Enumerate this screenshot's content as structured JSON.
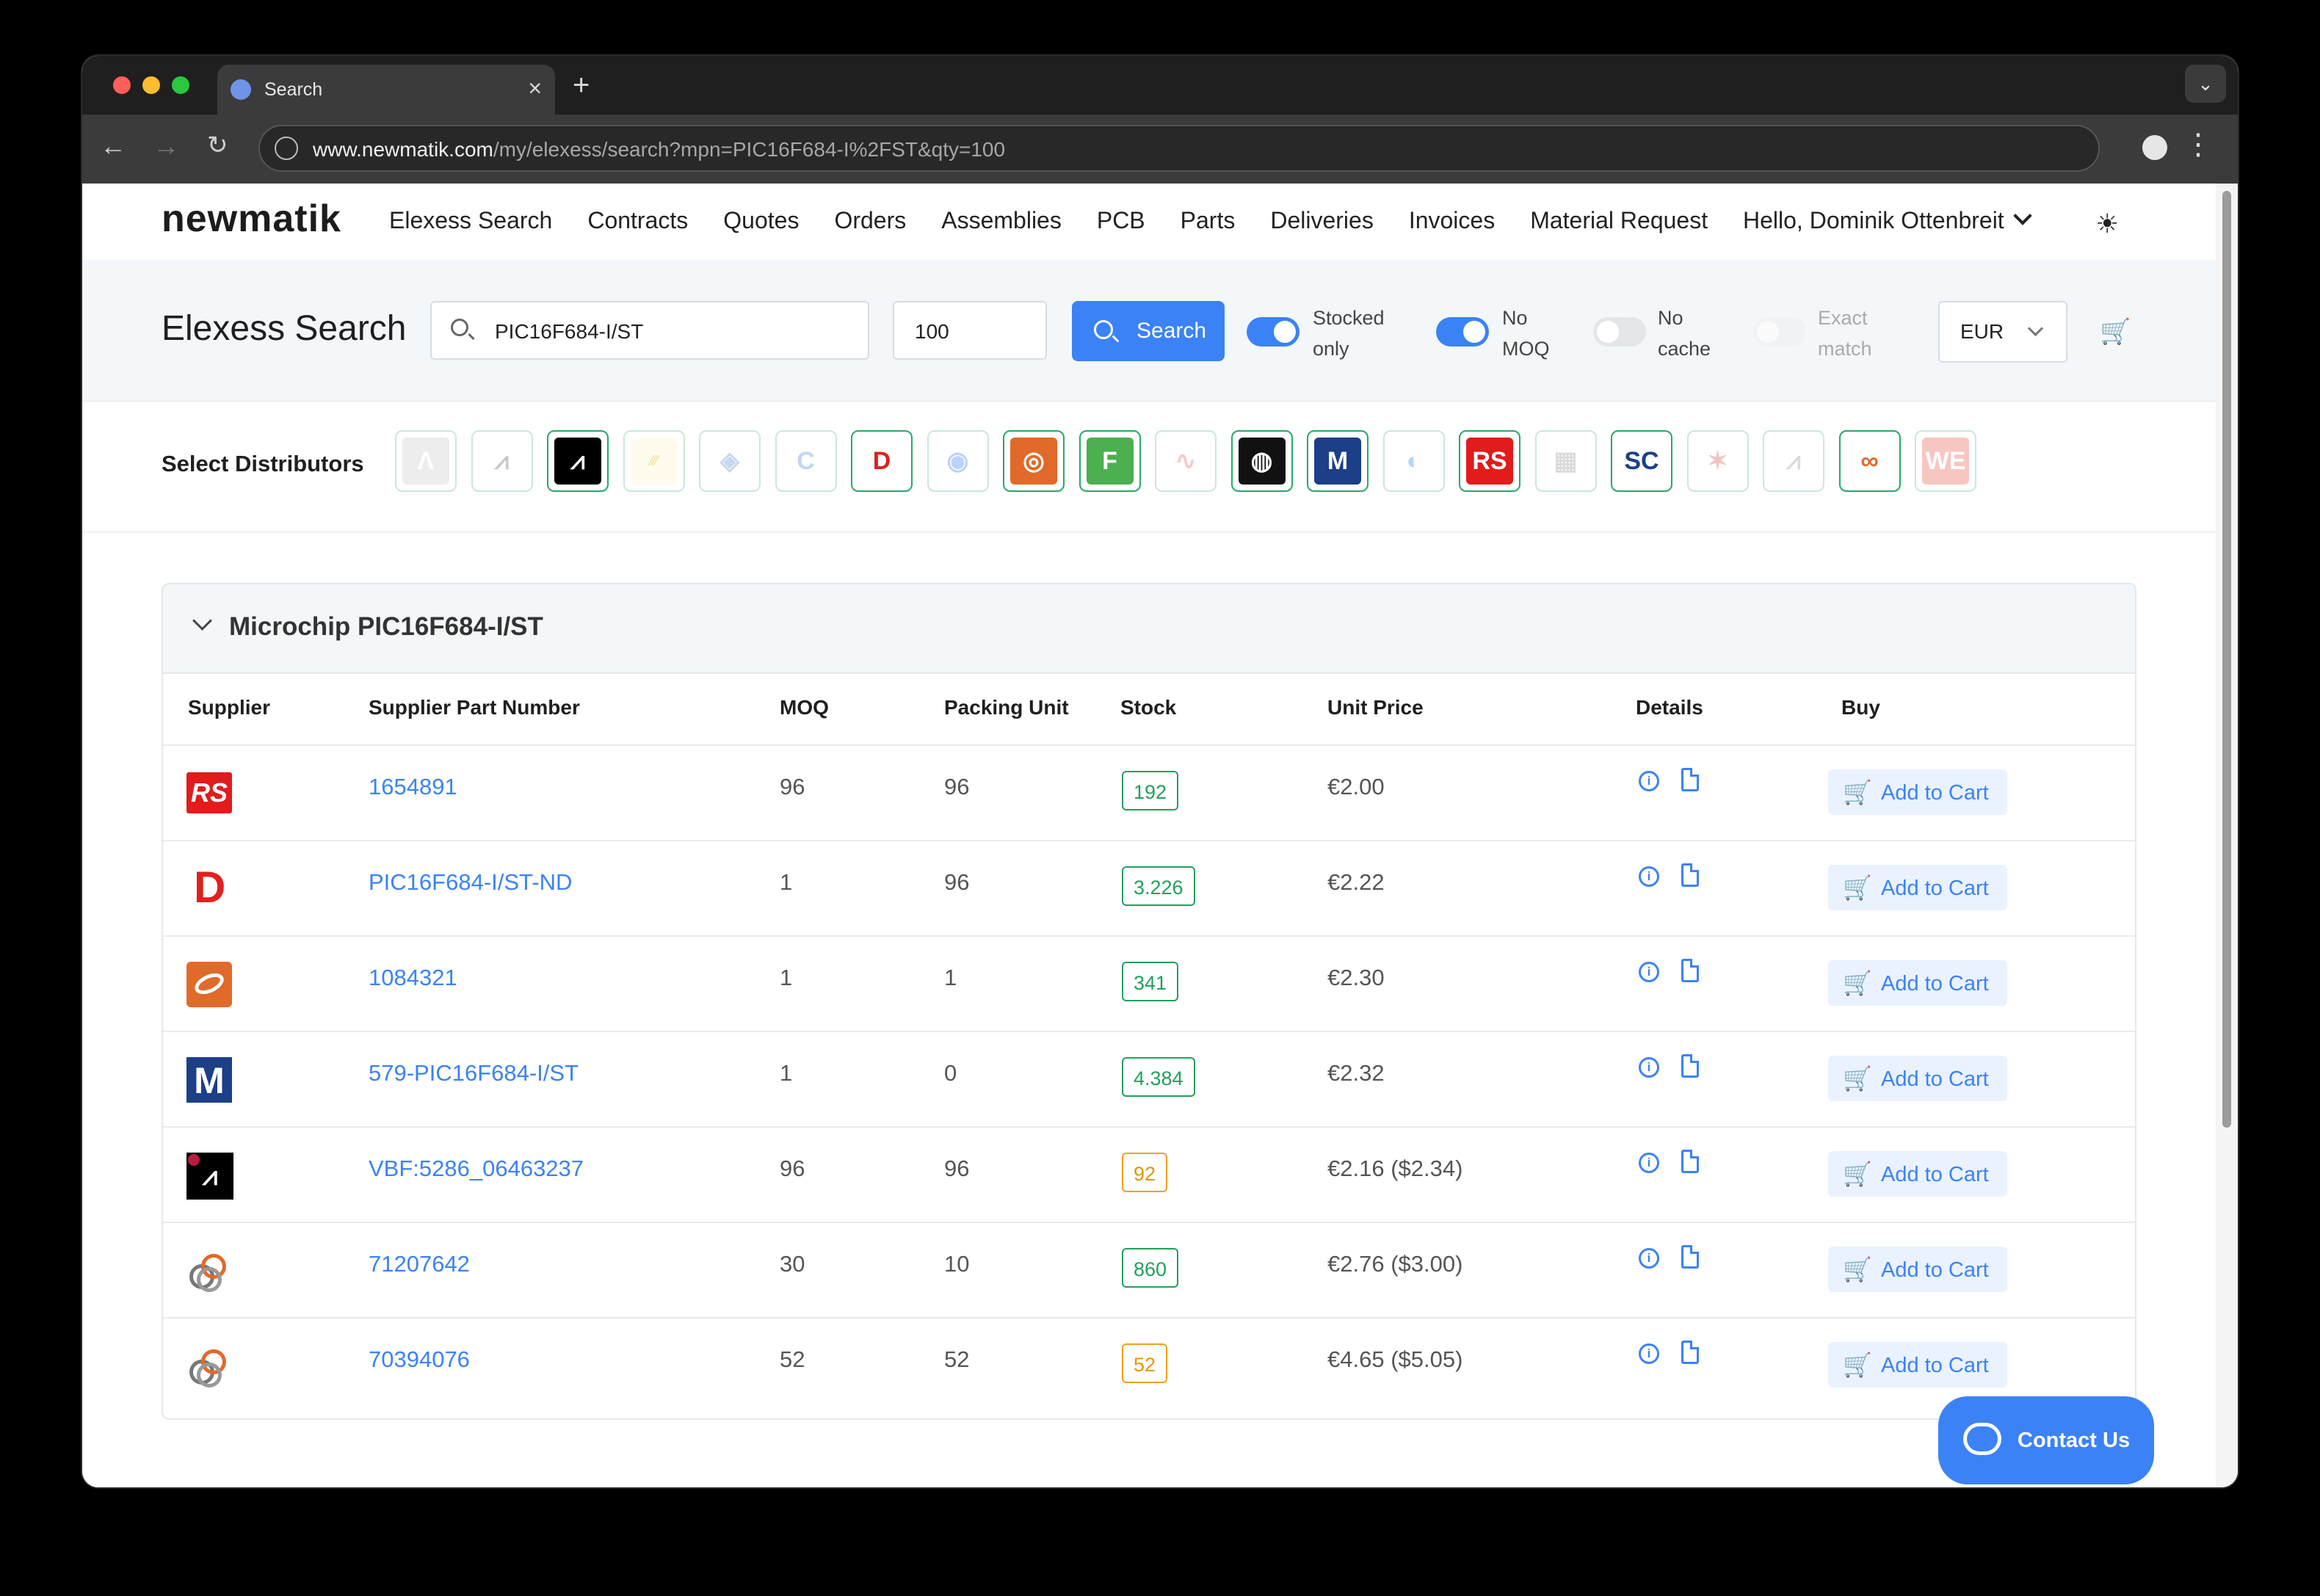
{
  "browser": {
    "tab_title": "Search",
    "url_host": "www.newmatik.com",
    "url_path": "/my/elexess/search?mpn=PIC16F684-I%2FST&qty=100"
  },
  "nav": {
    "logo": "newmatik",
    "items": [
      "Elexess Search",
      "Contracts",
      "Quotes",
      "Orders",
      "Assemblies",
      "PCB",
      "Parts",
      "Deliveries",
      "Invoices",
      "Material Request"
    ],
    "user": "Hello, Dominik Ottenbreit"
  },
  "search": {
    "title": "Elexess Search",
    "mpn": "PIC16F684-I/ST",
    "qty": "100",
    "button": "Search",
    "toggles": [
      {
        "line1": "Stocked",
        "line2": "only",
        "state": "on"
      },
      {
        "line1": "No",
        "line2": "MOQ",
        "state": "on"
      },
      {
        "line1": "No",
        "line2": "cache",
        "state": "off"
      },
      {
        "line1": "Exact",
        "line2": "match",
        "state": "disabled"
      }
    ],
    "currency": "EUR"
  },
  "distributors": {
    "label": "Select Distributors",
    "items": [
      {
        "icon": "abacus-icon",
        "selected": false
      },
      {
        "icon": "arrow-icon",
        "selected": false
      },
      {
        "icon": "arrow-usa-icon",
        "selected": true
      },
      {
        "icon": "tti-icon",
        "selected": false
      },
      {
        "icon": "diamond-icon",
        "selected": false
      },
      {
        "icon": "c-icon",
        "selected": false
      },
      {
        "icon": "digikey-icon",
        "selected": true
      },
      {
        "icon": "eye-icon",
        "selected": false
      },
      {
        "icon": "farnell-icon",
        "selected": true
      },
      {
        "icon": "future-icon",
        "selected": true
      },
      {
        "icon": "wave-icon",
        "selected": false
      },
      {
        "icon": "lcsc-icon",
        "selected": true
      },
      {
        "icon": "mouser-icon",
        "selected": true
      },
      {
        "icon": "globe-icon",
        "selected": false
      },
      {
        "icon": "rs-icon",
        "selected": true
      },
      {
        "icon": "grid-icon",
        "selected": false
      },
      {
        "icon": "sc-icon",
        "selected": true
      },
      {
        "icon": "ti-icon",
        "selected": false
      },
      {
        "icon": "wings-icon",
        "selected": false
      },
      {
        "icon": "rings-icon",
        "selected": true
      },
      {
        "icon": "we-icon",
        "selected": false
      }
    ]
  },
  "result": {
    "title": "Microchip PIC16F684-I/ST",
    "columns": [
      "Supplier",
      "Supplier Part Number",
      "MOQ",
      "Packing Unit",
      "Stock",
      "Unit Price",
      "Details",
      "Buy"
    ],
    "add_label": "Add to Cart",
    "rows": [
      {
        "supplier": "rs",
        "spn": "1654891",
        "moq": "96",
        "pack": "96",
        "stock": "192",
        "stock_level": "ok",
        "price": "€2.00"
      },
      {
        "supplier": "digikey",
        "spn": "PIC16F684-I/ST-ND",
        "moq": "1",
        "pack": "96",
        "stock": "3.226",
        "stock_level": "ok",
        "price": "€2.22"
      },
      {
        "supplier": "farnell",
        "spn": "1084321",
        "moq": "1",
        "pack": "1",
        "stock": "341",
        "stock_level": "ok",
        "price": "€2.30"
      },
      {
        "supplier": "mouser",
        "spn": "579-PIC16F684-I/ST",
        "moq": "1",
        "pack": "0",
        "stock": "4.384",
        "stock_level": "ok",
        "price": "€2.32"
      },
      {
        "supplier": "arrow-usa",
        "spn": "VBF:5286_06463237",
        "moq": "96",
        "pack": "96",
        "stock": "92",
        "stock_level": "low",
        "price": "€2.16 ($2.34)"
      },
      {
        "supplier": "rings",
        "spn": "71207642",
        "moq": "30",
        "pack": "10",
        "stock": "860",
        "stock_level": "ok",
        "price": "€2.76 ($3.00)"
      },
      {
        "supplier": "rings",
        "spn": "70394076",
        "moq": "52",
        "pack": "52",
        "stock": "52",
        "stock_level": "low",
        "price": "€4.65 ($5.05)"
      }
    ]
  },
  "contact": "Contact Us",
  "colors": {
    "accent": "#3b82f6",
    "stock_ok": "#22a05b",
    "stock_low": "#e59410"
  }
}
